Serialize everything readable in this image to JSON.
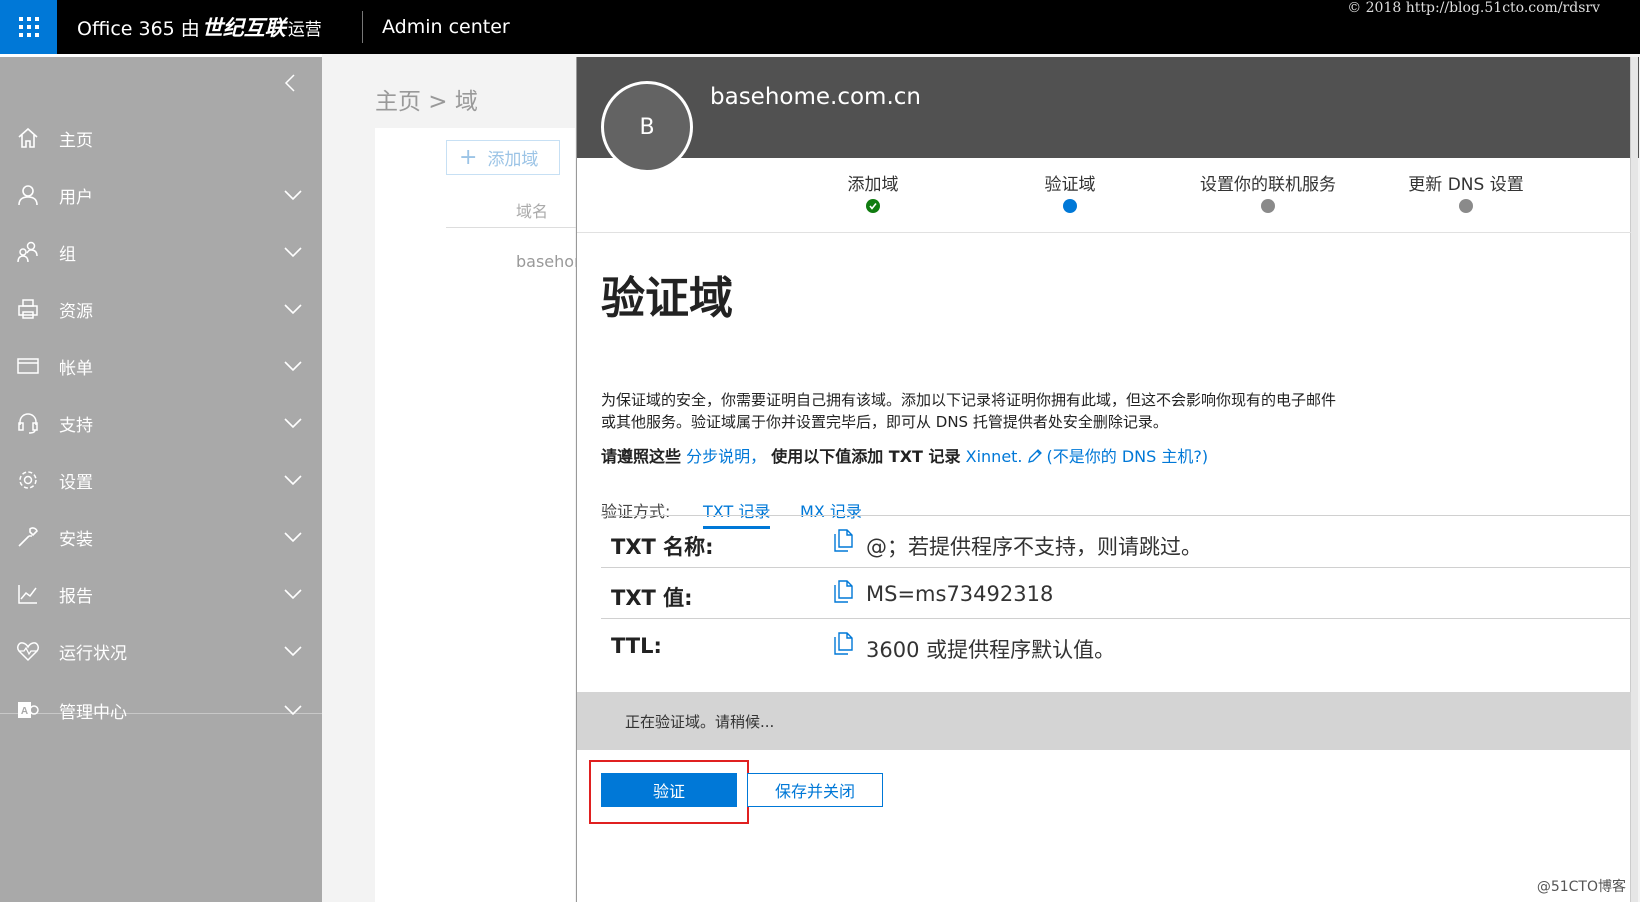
{
  "topbar": {
    "brand_prefix": "Office 365 由",
    "brand_bold": "世纪互联",
    "brand_suffix": "运营",
    "app_title": "Admin center",
    "copyright": "© 2018 http://blog.51cto.com/rdsrv"
  },
  "sidebar": {
    "items": [
      {
        "label": "主页",
        "icon": "home-icon"
      },
      {
        "label": "用户",
        "icon": "user-icon"
      },
      {
        "label": "组",
        "icon": "group-icon"
      },
      {
        "label": "资源",
        "icon": "printer-icon"
      },
      {
        "label": "帐单",
        "icon": "card-icon"
      },
      {
        "label": "支持",
        "icon": "headset-icon"
      },
      {
        "label": "设置",
        "icon": "gear-icon"
      },
      {
        "label": "安装",
        "icon": "wrench-icon"
      },
      {
        "label": "报告",
        "icon": "chart-icon"
      },
      {
        "label": "运行状况",
        "icon": "heart-icon"
      },
      {
        "label": "管理中心",
        "icon": "admin-icon"
      }
    ]
  },
  "main": {
    "breadcrumb": "主页 > 域",
    "add_domain": "添加域",
    "column_domain": "域名",
    "row_domain": "basehome.com.cn"
  },
  "panel": {
    "avatar_letter": "B",
    "domain": "basehome.com.cn",
    "steps": [
      {
        "label": "添加域",
        "state": "done"
      },
      {
        "label": "验证域",
        "state": "current"
      },
      {
        "label": "设置你的联机服务",
        "state": "todo"
      },
      {
        "label": "更新 DNS 设置",
        "state": "todo"
      }
    ],
    "heading": "验证域",
    "description_1": "为保证域的安全，你需要证明自己拥有该域。添加以下记录将证明你拥有此域，但这不会影响你现有的电子邮件",
    "description_2": "或其他服务。验证域属于你并设置完毕后，即可从 DNS 托管提供者处安全删除记录。",
    "instr_bold_1": "请遵照这些",
    "instr_link_1": "分步说明，",
    "instr_bold_2": "使用以下值添加 TXT 记录",
    "instr_link_2": "Xinnet.",
    "instr_link_3": "(不是你的 DNS 主机?)",
    "method_label": "验证方式:",
    "tab_txt": "TXT 记录",
    "tab_mx": "MX 记录",
    "records": [
      {
        "key": "TXT 名称:",
        "value": "@；若提供程序不支持，则请跳过。"
      },
      {
        "key": "TXT 值:",
        "value": "MS=ms73492318"
      },
      {
        "key": "TTL:",
        "value": "3600 或提供程序默认值。"
      }
    ],
    "status": "正在验证域。请稍候...",
    "verify_button": "验证",
    "save_close_button": "保存并关闭"
  },
  "watermark": "@51CTO博客",
  "colors": {
    "accent": "#0078d7",
    "done": "#107c10",
    "sidebar_bg": "#a9a9a9",
    "header_bg": "#515151",
    "highlight": "#e02020"
  }
}
